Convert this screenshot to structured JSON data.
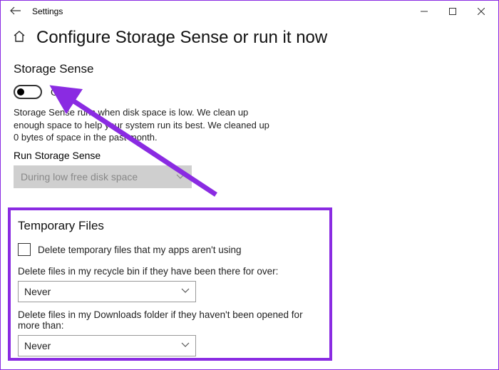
{
  "titlebar": {
    "title": "Settings"
  },
  "header": {
    "page_title": "Configure Storage Sense or run it now"
  },
  "storage_sense": {
    "section_title": "Storage Sense",
    "toggle_state": "Off",
    "description": "Storage Sense runs when disk space is low. We clean up enough space to help your system run its best. We cleaned up 0 bytes of space in the past month.",
    "run_label": "Run Storage Sense",
    "run_select": "During low free disk space"
  },
  "temp_files": {
    "section_title": "Temporary Files",
    "checkbox_label": "Delete temporary files that my apps aren't using",
    "recycle_label": "Delete files in my recycle bin if they have been there for over:",
    "recycle_select": "Never",
    "downloads_label": "Delete files in my Downloads folder if they haven't been opened for more than:",
    "downloads_select": "Never"
  },
  "annotation": {
    "arrow_color": "#8a2be2"
  }
}
